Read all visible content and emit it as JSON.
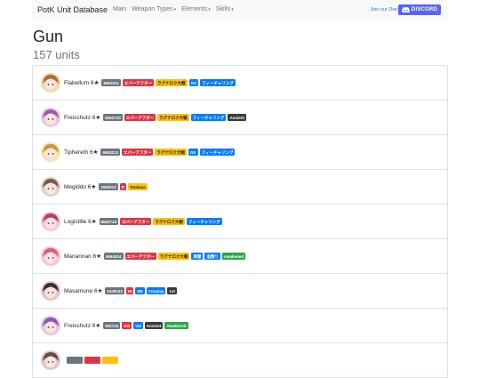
{
  "nav": {
    "brand": "PotK Unit Database",
    "items": [
      {
        "label": "Main",
        "dropdown": false
      },
      {
        "label": "Weapon Types",
        "dropdown": true
      },
      {
        "label": "Elements",
        "dropdown": true
      },
      {
        "label": "Skills",
        "dropdown": true
      }
    ],
    "join_text": "Join our Discord",
    "discord_label": "DISCORD"
  },
  "page": {
    "title": "Gun",
    "count": "157 units"
  },
  "units": [
    {
      "name": "Flabellum 6★",
      "colors": [
        "#f0d8a8",
        "#b06a3a"
      ],
      "badges": [
        {
          "text": "6561611",
          "color": "grey"
        },
        {
          "text": "エバーアフター",
          "color": "red"
        },
        {
          "text": "ラグナロク大戦",
          "color": "yellow"
        },
        {
          "text": "GS",
          "color": "blue"
        },
        {
          "text": "フィーチャリング",
          "color": "blue"
        }
      ]
    },
    {
      "name": "Freischutz 6★",
      "colors": [
        "#e8c8e0",
        "#9a5ea8"
      ],
      "badges": [
        {
          "text": "6562723",
          "color": "grey"
        },
        {
          "text": "エバーアフター",
          "color": "red"
        },
        {
          "text": "ラグナロク大戦",
          "color": "yellow"
        },
        {
          "text": "フィーチャリング",
          "color": "blue"
        },
        {
          "text": "Ancient",
          "color": "dark"
        }
      ]
    },
    {
      "name": "Tiphereth 6★",
      "colors": [
        "#f4e2b0",
        "#c49a3a"
      ],
      "badges": [
        {
          "text": "6563213",
          "color": "grey"
        },
        {
          "text": "エバーアフター",
          "color": "red"
        },
        {
          "text": "ラグナロク大戦",
          "color": "yellow"
        },
        {
          "text": "GK",
          "color": "blue"
        },
        {
          "text": "フィーチャリング",
          "color": "blue"
        }
      ]
    },
    {
      "name": "Megiddo 6★",
      "colors": [
        "#e4d0c0",
        "#7a5a48"
      ],
      "badges": [
        {
          "text": "2560013",
          "color": "grey"
        },
        {
          "text": "R",
          "color": "red"
        },
        {
          "text": "Tsukasa",
          "color": "yellow"
        }
      ]
    },
    {
      "name": "Logistille 6★",
      "colors": [
        "#f2c8d8",
        "#c23a6a"
      ],
      "badges": [
        {
          "text": "6563715",
          "color": "grey"
        },
        {
          "text": "エバーアフター",
          "color": "red"
        },
        {
          "text": "ラグナロク大戦",
          "color": "yellow"
        },
        {
          "text": "フィーチャリング",
          "color": "blue"
        }
      ]
    },
    {
      "name": "Manannan 6★",
      "colors": [
        "#f6c6d2",
        "#d4607e"
      ],
      "badges": [
        {
          "text": "6564024",
          "color": "grey"
        },
        {
          "text": "エバーアフター",
          "color": "red"
        },
        {
          "text": "ラグナロク大戦",
          "color": "yellow"
        },
        {
          "text": "異聞",
          "color": "blue"
        },
        {
          "text": "追憶り",
          "color": "blue"
        },
        {
          "text": "Awakened",
          "color": "green"
        }
      ]
    },
    {
      "name": "Masamune 6★",
      "colors": [
        "#e6c4c8",
        "#3a2a3a"
      ],
      "badges": [
        {
          "text": "5106143",
          "color": "grey"
        },
        {
          "text": "IN",
          "color": "red"
        },
        {
          "text": "BK",
          "color": "blue"
        },
        {
          "text": "Cosplay",
          "color": "blue"
        },
        {
          "text": "1st",
          "color": "dark"
        }
      ]
    },
    {
      "name": "Freischutz 6★",
      "colors": [
        "#e4c6e2",
        "#8a5aa8"
      ],
      "badges": [
        {
          "text": "562724",
          "color": "grey"
        },
        {
          "text": "OG",
          "color": "red"
        },
        {
          "text": "Val",
          "color": "blue"
        },
        {
          "text": "Ancient",
          "color": "dark"
        },
        {
          "text": "Awakened",
          "color": "green"
        }
      ]
    },
    {
      "name": "",
      "colors": [
        "#e0c8c8",
        "#6a4a4a"
      ],
      "badges": [
        {
          "text": "",
          "color": "grey"
        },
        {
          "text": "",
          "color": "red"
        },
        {
          "text": "",
          "color": "yellow"
        }
      ]
    }
  ]
}
